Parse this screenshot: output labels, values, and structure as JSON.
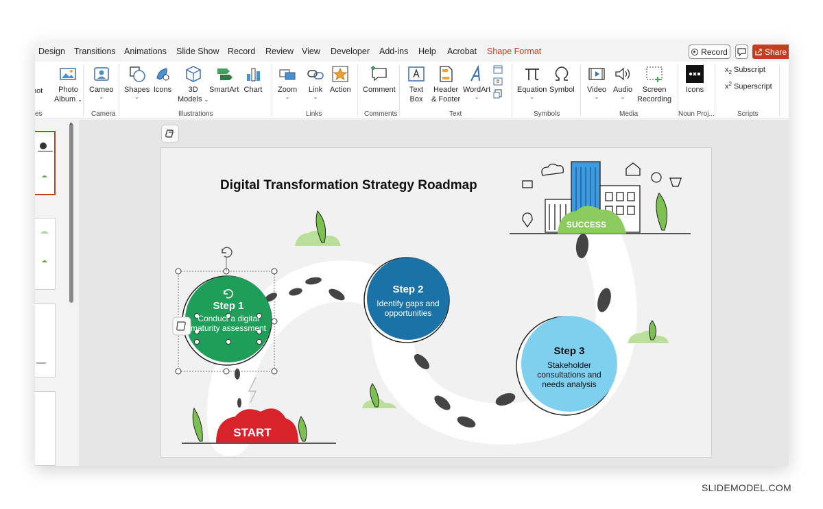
{
  "tabs": {
    "design": "Design",
    "transitions": "Transitions",
    "animations": "Animations",
    "slide_show": "Slide Show",
    "record": "Record",
    "review": "Review",
    "view": "View",
    "developer": "Developer",
    "add_ins": "Add-ins",
    "help": "Help",
    "acrobat": "Acrobat",
    "shape_format": "Shape Format"
  },
  "header_buttons": {
    "record": "Record",
    "share": "Share"
  },
  "ribbon": {
    "screenshot": "hot",
    "photo_album_1": "Photo",
    "photo_album_2": "Album",
    "cameo": "Cameo",
    "shapes": "Shapes",
    "icons": "Icons",
    "models_1": "3D",
    "models_2": "Models",
    "smartart": "SmartArt",
    "chart": "Chart",
    "zoom": "Zoom",
    "link": "Link",
    "action": "Action",
    "comment": "Comment",
    "text_box_1": "Text",
    "text_box_2": "Box",
    "header_footer_1": "Header",
    "header_footer_2": "& Footer",
    "wordart": "WordArt",
    "equation": "Equation",
    "symbol": "Symbol",
    "video": "Video",
    "audio": "Audio",
    "screen_recording_1": "Screen",
    "screen_recording_2": "Recording",
    "noun_icons": "Icons",
    "subscript": "Subscript",
    "superscript": "Superscript",
    "groups": {
      "images": "es",
      "camera": "Camera",
      "illustrations": "Illustrations",
      "links": "Links",
      "comments": "Comments",
      "text": "Text",
      "symbols": "Symbols",
      "media": "Media",
      "noun_project": "Noun Proj...",
      "scripts": "Scripts"
    }
  },
  "slide": {
    "title": "Digital Transformation Strategy Roadmap",
    "success_label": "SUCCESS",
    "start_label": "START",
    "steps": [
      {
        "title": "Step 1",
        "desc": "Conduct a digital maturity assessment",
        "color": "#1f9e5a"
      },
      {
        "title": "Step 2",
        "desc": "Identify gaps and opportunities",
        "color": "#1a72a6"
      },
      {
        "title": "Step 3",
        "desc": "Stakeholder consultations and needs analysis",
        "color": "#7fd0ef"
      }
    ]
  },
  "colors": {
    "accent": "#c43e1c",
    "start_cloud": "#d8232a",
    "success_cloud": "#8ccb5e",
    "footprint": "#444444"
  },
  "watermark": "SLIDEMODEL.COM"
}
